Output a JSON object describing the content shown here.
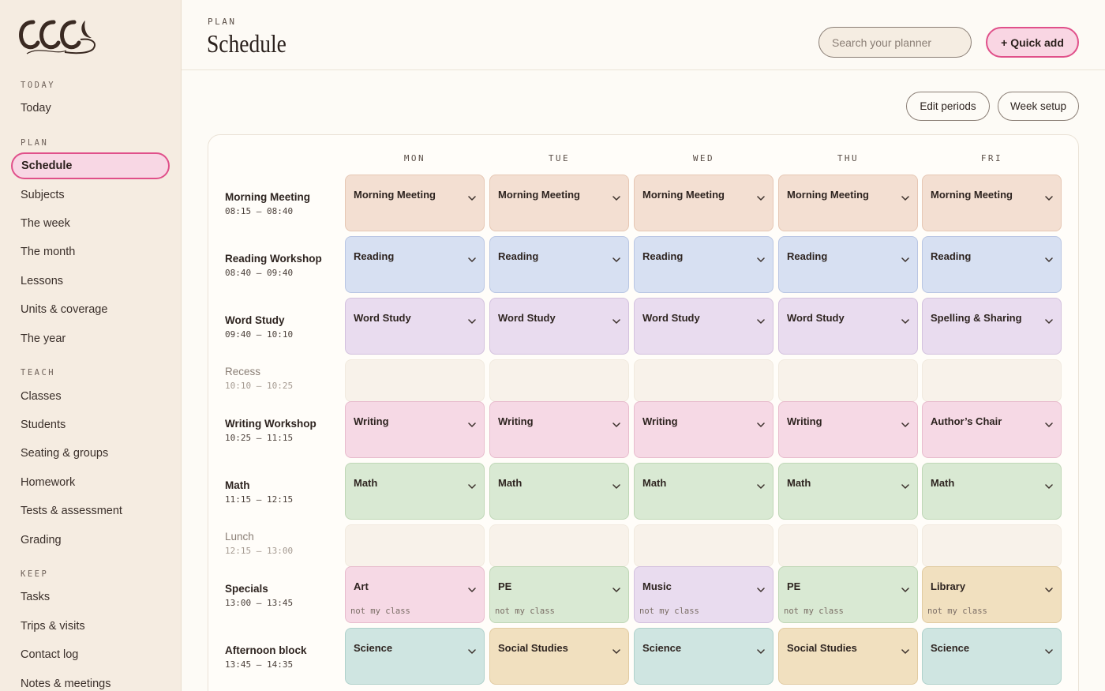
{
  "sidebar": {
    "sections": [
      {
        "title": "TODAY",
        "items": [
          "Today"
        ]
      },
      {
        "title": "PLAN",
        "items": [
          "Schedule",
          "Subjects",
          "The week",
          "The month",
          "Lessons",
          "Units & coverage",
          "The year"
        ]
      },
      {
        "title": "TEACH",
        "items": [
          "Classes",
          "Students",
          "Seating & groups",
          "Homework",
          "Tests & assessment",
          "Grading"
        ]
      },
      {
        "title": "KEEP",
        "items": [
          "Tasks",
          "Trips & visits",
          "Contact log",
          "Notes & meetings"
        ]
      }
    ],
    "active_item": "Schedule"
  },
  "header": {
    "eyebrow": "PLAN",
    "title": "Schedule",
    "search_placeholder": "Search your planner",
    "quick_add_label": "+ Quick add"
  },
  "toolbar": {
    "edit_periods_label": "Edit periods",
    "week_setup_label": "Week setup"
  },
  "schedule": {
    "days": [
      "MON",
      "TUE",
      "WED",
      "THU",
      "FRI"
    ],
    "periods": [
      {
        "name": "Morning Meeting",
        "time": "08:15 – 08:40",
        "muted": false,
        "cells": [
          {
            "label": "Morning Meeting",
            "color": "peach"
          },
          {
            "label": "Morning Meeting",
            "color": "peach"
          },
          {
            "label": "Morning Meeting",
            "color": "peach"
          },
          {
            "label": "Morning Meeting",
            "color": "peach"
          },
          {
            "label": "Morning Meeting",
            "color": "peach"
          }
        ]
      },
      {
        "name": "Reading Workshop",
        "time": "08:40 – 09:40",
        "muted": false,
        "cells": [
          {
            "label": "Reading",
            "color": "blue"
          },
          {
            "label": "Reading",
            "color": "blue"
          },
          {
            "label": "Reading",
            "color": "blue"
          },
          {
            "label": "Reading",
            "color": "blue"
          },
          {
            "label": "Reading",
            "color": "blue"
          }
        ]
      },
      {
        "name": "Word Study",
        "time": "09:40 – 10:10",
        "muted": false,
        "cells": [
          {
            "label": "Word Study",
            "color": "lav"
          },
          {
            "label": "Word Study",
            "color": "lav"
          },
          {
            "label": "Word Study",
            "color": "lav"
          },
          {
            "label": "Word Study",
            "color": "lav"
          },
          {
            "label": "Spelling & Sharing",
            "color": "lav"
          }
        ]
      },
      {
        "name": "Recess",
        "time": "10:10 – 10:25",
        "muted": true,
        "cells": []
      },
      {
        "name": "Writing Workshop",
        "time": "10:25 – 11:15",
        "muted": false,
        "cells": [
          {
            "label": "Writing",
            "color": "pink"
          },
          {
            "label": "Writing",
            "color": "pink"
          },
          {
            "label": "Writing",
            "color": "pink"
          },
          {
            "label": "Writing",
            "color": "pink"
          },
          {
            "label": "Author’s Chair",
            "color": "pink"
          }
        ]
      },
      {
        "name": "Math",
        "time": "11:15 – 12:15",
        "muted": false,
        "cells": [
          {
            "label": "Math",
            "color": "green"
          },
          {
            "label": "Math",
            "color": "green"
          },
          {
            "label": "Math",
            "color": "green"
          },
          {
            "label": "Math",
            "color": "green"
          },
          {
            "label": "Math",
            "color": "green"
          }
        ]
      },
      {
        "name": "Lunch",
        "time": "12:15 – 13:00",
        "muted": true,
        "cells": []
      },
      {
        "name": "Specials",
        "time": "13:00 – 13:45",
        "muted": false,
        "cells": [
          {
            "label": "Art",
            "color": "pink",
            "note": "not my class"
          },
          {
            "label": "PE",
            "color": "green",
            "note": "not my class"
          },
          {
            "label": "Music",
            "color": "lav",
            "note": "not my class"
          },
          {
            "label": "PE",
            "color": "green",
            "note": "not my class"
          },
          {
            "label": "Library",
            "color": "tan",
            "note": "not my class"
          }
        ]
      },
      {
        "name": "Afternoon block",
        "time": "13:45 – 14:35",
        "muted": false,
        "cells": [
          {
            "label": "Science",
            "color": "teal"
          },
          {
            "label": "Social Studies",
            "color": "tan"
          },
          {
            "label": "Science",
            "color": "teal"
          },
          {
            "label": "Social Studies",
            "color": "tan"
          },
          {
            "label": "Science",
            "color": "teal"
          }
        ]
      }
    ]
  },
  "colors": {
    "accent": "#e0508a",
    "accent_bg": "#f8d7e4",
    "sidebar_bg": "#f5ece1",
    "page_bg": "#fdfbf6"
  }
}
